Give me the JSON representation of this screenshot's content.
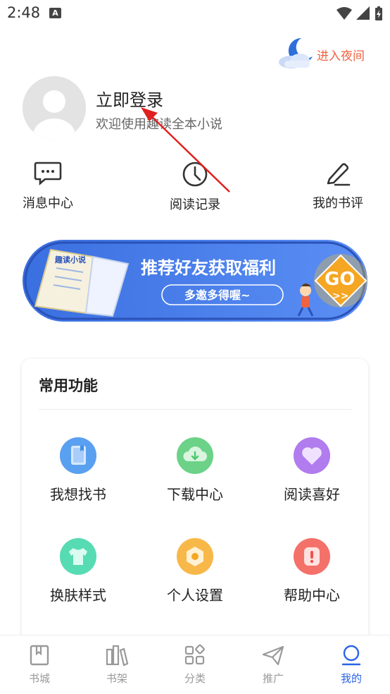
{
  "status_bar": {
    "time": "2:48",
    "notification_glyph": "A"
  },
  "night_mode": {
    "label": "进入夜间",
    "icon": "moon-cloud-icon"
  },
  "profile": {
    "title": "立即登录",
    "subtitle": "欢迎使用趣读全本小说"
  },
  "quick_links": [
    {
      "label": "消息中心",
      "icon": "message-icon"
    },
    {
      "label": "阅读记录",
      "icon": "clock-icon"
    },
    {
      "label": "我的书评",
      "icon": "pen-icon"
    }
  ],
  "banner": {
    "title": "推荐好友获取福利",
    "subtitle": "多邀多得喔~",
    "book_text": "趣读小说",
    "go_text": "GO",
    "go_arrows": ">>"
  },
  "common_functions": {
    "title": "常用功能",
    "items": [
      {
        "label": "我想找书",
        "icon": "book-icon",
        "color": "#3f8ee8"
      },
      {
        "label": "下载中心",
        "icon": "cloud-download-icon",
        "color": "#4cc66d"
      },
      {
        "label": "阅读喜好",
        "icon": "heart-icon",
        "color": "#9b5de5"
      },
      {
        "label": "换肤样式",
        "icon": "shirt-icon",
        "color": "#2fd0a0"
      },
      {
        "label": "个人设置",
        "icon": "settings-icon",
        "color": "#f5a623"
      },
      {
        "label": "帮助中心",
        "icon": "help-icon",
        "color": "#f0524b"
      }
    ]
  },
  "bottom_nav": [
    {
      "label": "书城",
      "icon": "bookstore-icon",
      "active": false
    },
    {
      "label": "书架",
      "icon": "bookshelf-icon",
      "active": false
    },
    {
      "label": "分类",
      "icon": "category-icon",
      "active": false
    },
    {
      "label": "推广",
      "icon": "send-icon",
      "active": false
    },
    {
      "label": "我的",
      "icon": "user-icon",
      "active": true
    }
  ],
  "colors": {
    "accent": "#2b63e6",
    "night_text": "#f06240",
    "annotation_arrow": "#e02020"
  }
}
